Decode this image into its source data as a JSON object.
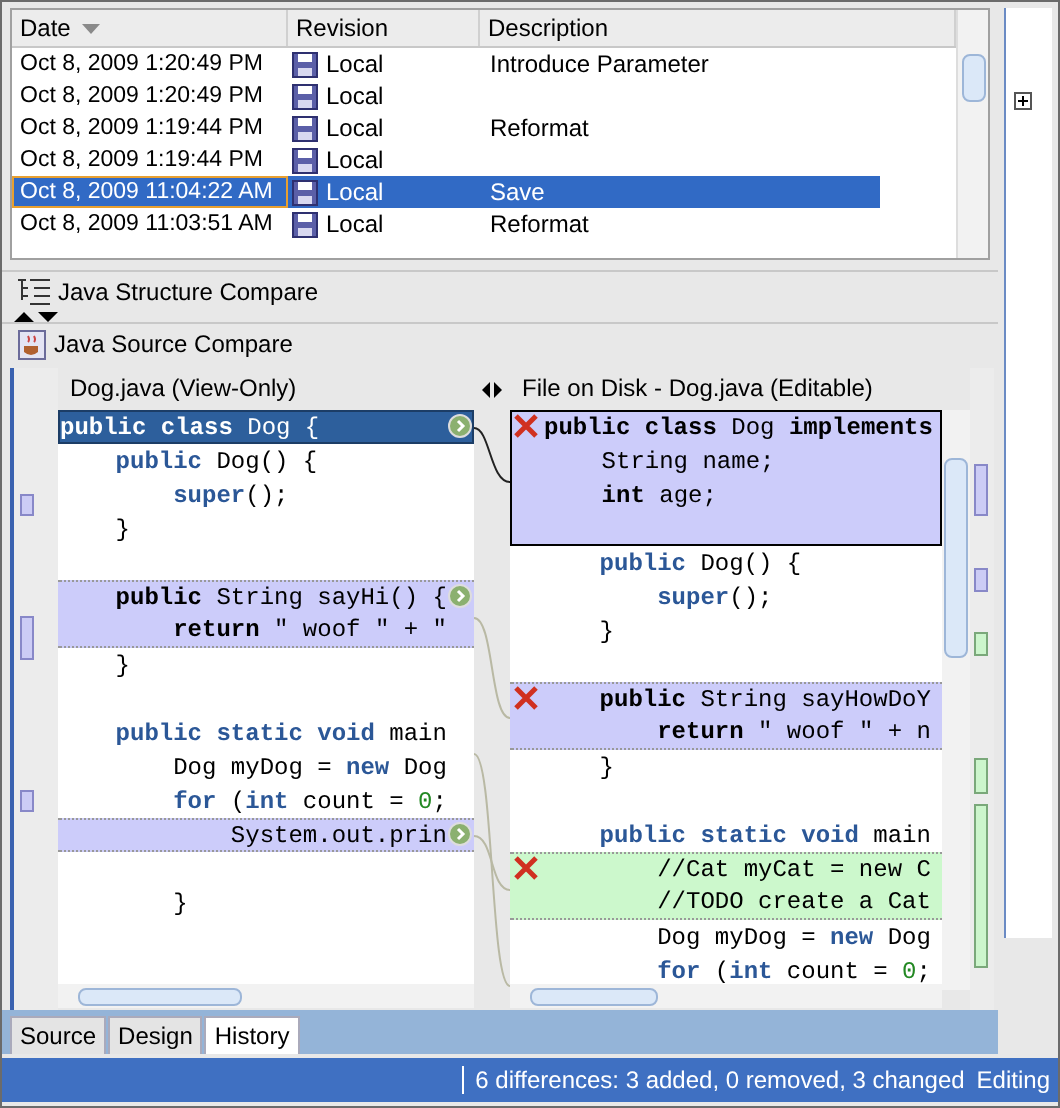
{
  "history_table": {
    "columns": [
      {
        "label": "Date",
        "sorted": true
      },
      {
        "label": "Revision",
        "sorted": false
      },
      {
        "label": "Description",
        "sorted": false
      }
    ],
    "rows": [
      {
        "date": "Oct 8, 2009 1:20:49 PM",
        "revision": "Local",
        "description": "Introduce Parameter",
        "selected": false
      },
      {
        "date": "Oct 8, 2009 1:20:49 PM",
        "revision": "Local",
        "selected": false
      },
      {
        "date": "Oct 8, 2009 1:19:44 PM",
        "revision": "Local",
        "description": "Reformat",
        "selected": false
      },
      {
        "date": "Oct 8, 2009 1:19:44 PM",
        "revision": "Local",
        "selected": false
      },
      {
        "date": "Oct 8, 2009 11:04:22 AM",
        "revision": "Local",
        "description": "Save",
        "selected": true
      },
      {
        "date": "Oct 8, 2009 11:03:51 AM",
        "revision": "Local",
        "description": "Reformat",
        "selected": false
      }
    ]
  },
  "compare_tabs": [
    {
      "label": "Java Structure Compare",
      "kind": "structure"
    },
    {
      "label": "Java Source Compare",
      "kind": "source"
    }
  ],
  "left_pane": {
    "title": "Dog.java (View-Only)",
    "lines": [
      {
        "kind": "selected",
        "marker": true,
        "segments": [
          {
            "text": "public class",
            "kind": "keyword"
          },
          {
            "text": " Dog {",
            "kind": "text"
          }
        ]
      },
      {
        "kind": "plain",
        "marker": false,
        "segments": [
          {
            "text": "    public",
            "kind": "keyword"
          },
          {
            "text": " Dog() {",
            "kind": "text"
          }
        ]
      },
      {
        "kind": "plain",
        "marker": false,
        "segments": [
          {
            "text": "        super",
            "kind": "keyword"
          },
          {
            "text": "();",
            "kind": "text"
          }
        ]
      },
      {
        "kind": "plain",
        "marker": false,
        "segments": [
          {
            "text": "    }",
            "kind": "text"
          }
        ]
      },
      {
        "kind": "plain",
        "marker": false
      },
      {
        "kind": "changed",
        "marker": true,
        "segments": [
          {
            "text": "    public",
            "kind": "keyword"
          },
          {
            "text": " String sayHi() {",
            "kind": "text"
          }
        ]
      },
      {
        "kind": "changed",
        "marker": false,
        "segments": [
          {
            "text": "        return",
            "kind": "keyword"
          },
          {
            "text": " \" woof \" + \"",
            "kind": "text"
          }
        ]
      },
      {
        "kind": "plain",
        "marker": false,
        "segments": [
          {
            "text": "    }",
            "kind": "text"
          }
        ]
      },
      {
        "kind": "plain",
        "marker": false
      },
      {
        "kind": "plain",
        "marker": false,
        "segments": [
          {
            "text": "    public static void",
            "kind": "keyword"
          },
          {
            "text": " main",
            "kind": "text"
          }
        ]
      },
      {
        "kind": "plain",
        "marker": false,
        "segments": [
          {
            "text": "        Dog myDog = ",
            "kind": "text"
          },
          {
            "text": "new",
            "kind": "keyword"
          },
          {
            "text": " Dog",
            "kind": "text"
          }
        ]
      },
      {
        "kind": "plain",
        "marker": false,
        "segments": [
          {
            "text": "        for",
            "kind": "keyword"
          },
          {
            "text": " (",
            "kind": "text"
          },
          {
            "text": "int",
            "kind": "keyword"
          },
          {
            "text": " count = ",
            "kind": "text"
          },
          {
            "text": "0",
            "kind": "number"
          },
          {
            "text": ";",
            "kind": "text"
          }
        ]
      },
      {
        "kind": "changed",
        "marker": true,
        "segments": [
          {
            "text": "            System.out.prin",
            "kind": "text"
          }
        ]
      },
      {
        "kind": "plain",
        "marker": false
      },
      {
        "kind": "plain",
        "marker": false,
        "segments": [
          {
            "text": "        }",
            "kind": "text"
          }
        ]
      }
    ]
  },
  "right_pane": {
    "title": "File on Disk - Dog.java (Editable)",
    "lines": [
      {
        "kind": "current",
        "marker": true,
        "segments": [
          {
            "text": "public class",
            "kind": "keyword"
          },
          {
            "text": " Dog ",
            "kind": "text"
          },
          {
            "text": "implements",
            "kind": "keyword"
          }
        ]
      },
      {
        "kind": "current",
        "marker": false,
        "segments": [
          {
            "text": "    String name;",
            "kind": "text"
          }
        ]
      },
      {
        "kind": "current",
        "marker": false,
        "segments": [
          {
            "text": "    int",
            "kind": "keyword"
          },
          {
            "text": " age;",
            "kind": "text"
          }
        ]
      },
      {
        "kind": "current",
        "marker": false
      },
      {
        "kind": "plain",
        "marker": false,
        "segments": [
          {
            "text": "    public",
            "kind": "keyword"
          },
          {
            "text": " Dog() {",
            "kind": "text"
          }
        ]
      },
      {
        "kind": "plain",
        "marker": false,
        "segments": [
          {
            "text": "        super",
            "kind": "keyword"
          },
          {
            "text": "();",
            "kind": "text"
          }
        ]
      },
      {
        "kind": "plain",
        "marker": false,
        "segments": [
          {
            "text": "    }",
            "kind": "text"
          }
        ]
      },
      {
        "kind": "plain",
        "marker": false
      },
      {
        "kind": "changed",
        "marker": true,
        "segments": [
          {
            "text": "    public",
            "kind": "keyword"
          },
          {
            "text": " String sayHowDoY",
            "kind": "text"
          }
        ]
      },
      {
        "kind": "changed",
        "marker": false,
        "segments": [
          {
            "text": "        return",
            "kind": "keyword"
          },
          {
            "text": " \" woof \" + n",
            "kind": "text"
          }
        ]
      },
      {
        "kind": "plain",
        "marker": false,
        "segments": [
          {
            "text": "    }",
            "kind": "text"
          }
        ]
      },
      {
        "kind": "plain",
        "marker": false
      },
      {
        "kind": "plain",
        "marker": false,
        "segments": [
          {
            "text": "    public static void",
            "kind": "keyword"
          },
          {
            "text": " main",
            "kind": "text"
          }
        ]
      },
      {
        "kind": "added",
        "marker": true,
        "segments": [
          {
            "text": "        //Cat myCat = new C",
            "kind": "text"
          }
        ]
      },
      {
        "kind": "added",
        "marker": false,
        "segments": [
          {
            "text": "        //TODO create a Cat",
            "kind": "text"
          }
        ]
      },
      {
        "kind": "plain",
        "marker": false,
        "segments": [
          {
            "text": "        Dog myDog = ",
            "kind": "text"
          },
          {
            "text": "new",
            "kind": "keyword"
          },
          {
            "text": " Dog",
            "kind": "text"
          }
        ]
      },
      {
        "kind": "plain",
        "marker": false,
        "segments": [
          {
            "text": "        for",
            "kind": "keyword"
          },
          {
            "text": " (",
            "kind": "text"
          },
          {
            "text": "int",
            "kind": "keyword"
          },
          {
            "text": " count = ",
            "kind": "text"
          },
          {
            "text": "0",
            "kind": "number"
          },
          {
            "text": ";",
            "kind": "text"
          }
        ]
      }
    ]
  },
  "bottom_tabs": [
    {
      "label": "Source",
      "selected": false
    },
    {
      "label": "Design",
      "selected": false
    },
    {
      "label": "History",
      "selected": true
    }
  ],
  "status_bar": {
    "summary": "6 differences: 3 added, 0 removed, 3 changed",
    "mode": "Editing"
  }
}
